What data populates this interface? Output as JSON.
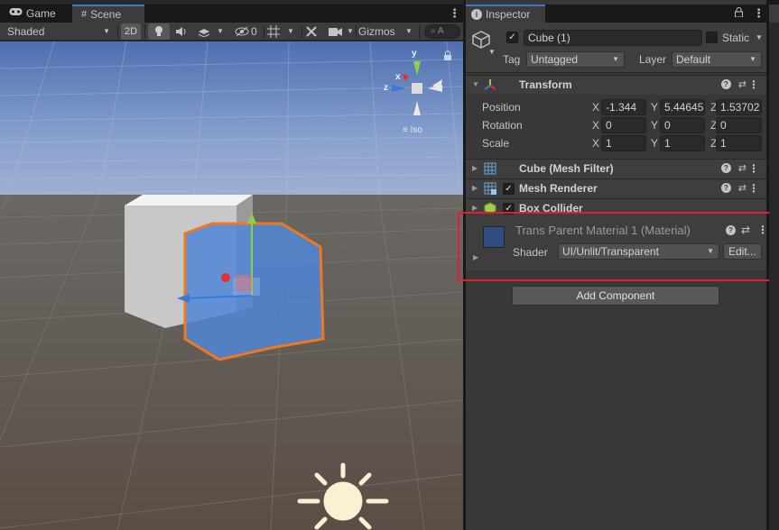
{
  "scene_window": {
    "tabs": [
      {
        "label": "Game",
        "icon": "gamepad-icon",
        "active": false
      },
      {
        "label": "Scene",
        "icon": "hash-grid-icon",
        "active": true
      }
    ],
    "toolbar": {
      "shading_mode": "Shaded",
      "toggle_2d": "2D",
      "hidden_count": "0",
      "gizmos_label": "Gizmos",
      "search_placeholder": "A"
    },
    "orientation_gizmo": {
      "axis_y": "y",
      "axis_x": "x",
      "axis_z": "z",
      "projection_label": "Iso"
    }
  },
  "inspector": {
    "tab_label": "Inspector",
    "game_object": {
      "name": "Cube (1)",
      "active": true,
      "static_label": "Static",
      "tag_label": "Tag",
      "tag_value": "Untagged",
      "layer_label": "Layer",
      "layer_value": "Default"
    },
    "transform": {
      "title": "Transform",
      "position_label": "Position",
      "rotation_label": "Rotation",
      "scale_label": "Scale",
      "axis_labels": [
        "X",
        "Y",
        "Z"
      ],
      "position": [
        "-1.344",
        "5.44645",
        "1.53702"
      ],
      "rotation": [
        "0",
        "0",
        "0"
      ],
      "scale": [
        "1",
        "1",
        "1"
      ]
    },
    "components": [
      {
        "title": "Cube (Mesh Filter)",
        "has_checkbox": false
      },
      {
        "title": "Mesh Renderer",
        "has_checkbox": true
      },
      {
        "title": "Box Collider",
        "has_checkbox": true
      }
    ],
    "material": {
      "title": "Trans Parent Material 1 (Material)",
      "shader_label": "Shader",
      "shader_value": "UI/Unlit/Transparent",
      "edit_label": "Edit...",
      "swatch_color": "#2f4d80"
    },
    "add_component_label": "Add Component"
  },
  "colors": {
    "selection_outline": "#f07820",
    "highlight_box": "#e0212b",
    "tab_accent": "#3a79bb",
    "selected_cube": "#4f86d6"
  }
}
